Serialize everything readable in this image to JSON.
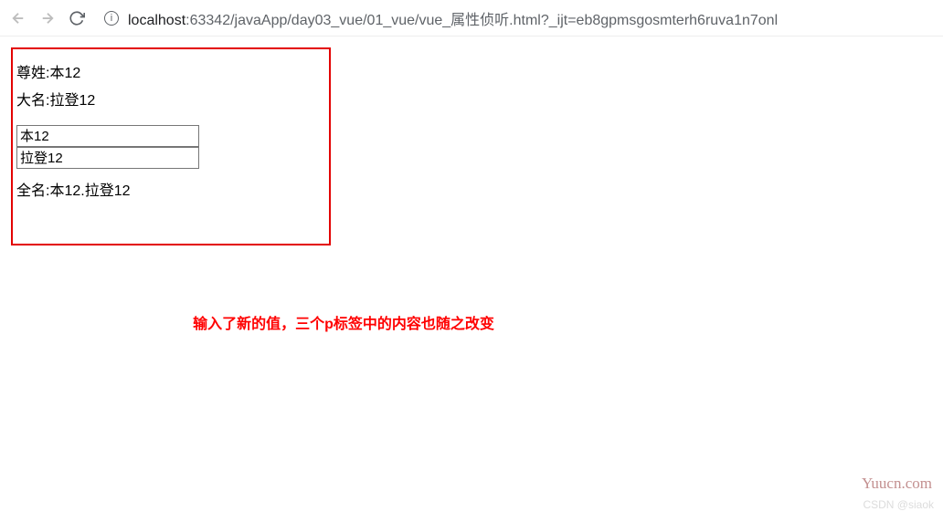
{
  "browser": {
    "url_host": "localhost",
    "url_port": ":63342",
    "url_path": "/javaApp/day03_vue/01_vue/vue_属性侦听.html?_ijt=eb8gpmsgosmterh6ruva1n7onl"
  },
  "page": {
    "label_surname": "尊姓:",
    "value_surname": "本12",
    "label_givenname": "大名:",
    "value_givenname": "拉登12",
    "input1_value": "本12",
    "input2_value": "拉登12",
    "label_fullname": "全名:",
    "value_fullname": "本12.拉登12"
  },
  "annotation": "输入了新的值，三个p标签中的内容也随之改变",
  "watermarks": {
    "yuucn": "Yuucn.com",
    "csdn": "CSDN @siaok"
  }
}
